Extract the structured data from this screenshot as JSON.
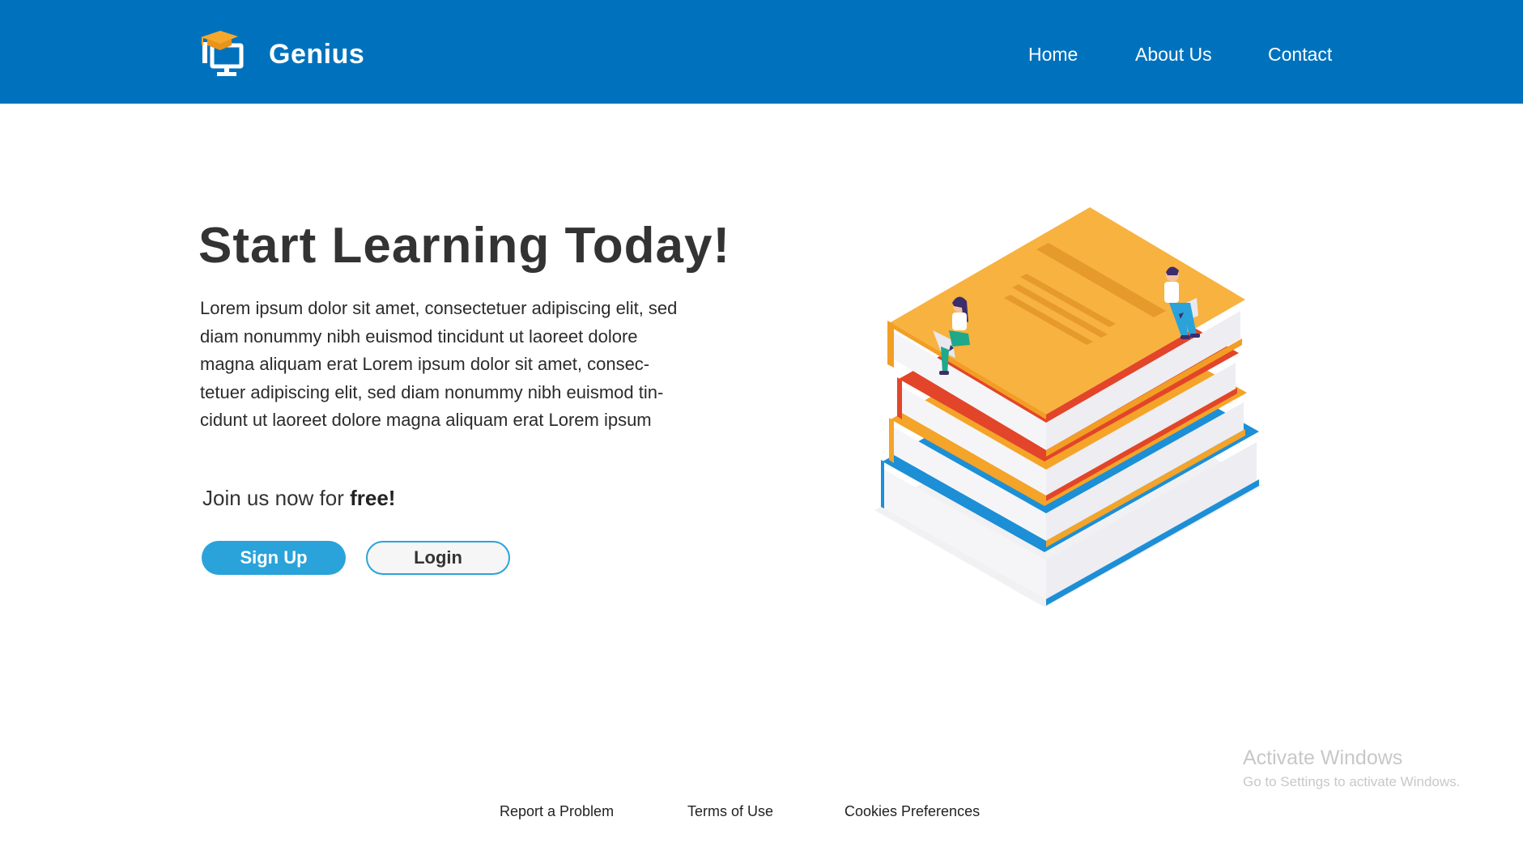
{
  "header": {
    "brand": "Genius",
    "nav": {
      "home": "Home",
      "about": "About Us",
      "contact": "Contact"
    }
  },
  "hero": {
    "title": "Start Learning Today!",
    "body_lines": [
      "Lorem ipsum dolor sit amet, consectetuer adipiscing elit, sed",
      "diam nonummy nibh euismod tincidunt ut laoreet dolore",
      "magna aliquam erat Lorem ipsum dolor sit amet, consec-",
      "tetuer adipiscing elit, sed diam nonummy nibh euismod tin-",
      "cidunt ut laoreet dolore magna aliquam erat Lorem ipsum"
    ],
    "join_prefix": "Join us now for ",
    "join_emphasis": "free!",
    "signup_label": "Sign Up",
    "login_label": "Login"
  },
  "watermark": {
    "title": "Activate Windows",
    "subtitle": "Go to Settings to activate Windows."
  },
  "footer": {
    "report": "Report a Problem",
    "terms": "Terms of Use",
    "cookies": "Cookies Preferences"
  },
  "colors": {
    "header_bg": "#0072BD",
    "accent": "#29A3DA",
    "heading": "#333333"
  },
  "icons": {
    "logo": "graduation-cap-monitor-icon"
  }
}
